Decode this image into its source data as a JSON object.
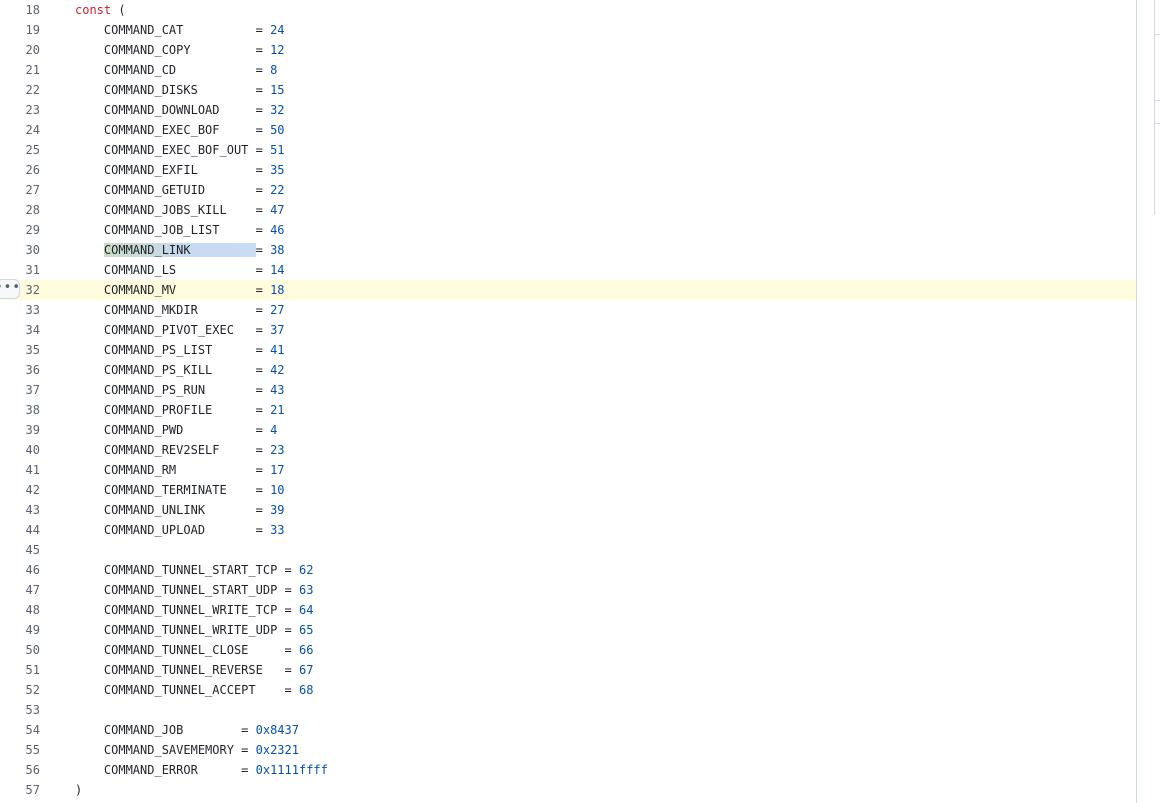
{
  "gutter_menu_icon": "kebab-horizontal-icon",
  "gutter_menu_glyph": "•••",
  "lines": [
    {
      "n": "18",
      "parts": [
        {
          "t": "const",
          "c": "kw"
        },
        {
          "t": " ("
        }
      ]
    },
    {
      "n": "19",
      "parts": [
        {
          "t": "    COMMAND_CAT          = "
        },
        {
          "t": "24",
          "c": "num"
        }
      ]
    },
    {
      "n": "20",
      "parts": [
        {
          "t": "    COMMAND_COPY         = "
        },
        {
          "t": "12",
          "c": "num"
        }
      ]
    },
    {
      "n": "21",
      "parts": [
        {
          "t": "    COMMAND_CD           = "
        },
        {
          "t": "8",
          "c": "num"
        }
      ]
    },
    {
      "n": "22",
      "parts": [
        {
          "t": "    COMMAND_DISKS        = "
        },
        {
          "t": "15",
          "c": "num"
        }
      ]
    },
    {
      "n": "23",
      "parts": [
        {
          "t": "    COMMAND_DOWNLOAD     = "
        },
        {
          "t": "32",
          "c": "num"
        }
      ]
    },
    {
      "n": "24",
      "parts": [
        {
          "t": "    COMMAND_EXEC_BOF     = "
        },
        {
          "t": "50",
          "c": "num"
        }
      ]
    },
    {
      "n": "25",
      "parts": [
        {
          "t": "    COMMAND_EXEC_BOF_OUT = "
        },
        {
          "t": "51",
          "c": "num"
        }
      ]
    },
    {
      "n": "26",
      "parts": [
        {
          "t": "    COMMAND_EXFIL        = "
        },
        {
          "t": "35",
          "c": "num"
        }
      ]
    },
    {
      "n": "27",
      "parts": [
        {
          "t": "    COMMAND_GETUID       = "
        },
        {
          "t": "22",
          "c": "num"
        }
      ]
    },
    {
      "n": "28",
      "parts": [
        {
          "t": "    COMMAND_JOBS_KILL    = "
        },
        {
          "t": "47",
          "c": "num"
        }
      ]
    },
    {
      "n": "29",
      "parts": [
        {
          "t": "    COMMAND_JOB_LIST     = "
        },
        {
          "t": "46",
          "c": "num"
        }
      ]
    },
    {
      "n": "30",
      "parts": [
        {
          "t": "    "
        },
        {
          "t": "COMMAND_LINK         ",
          "c": "sel"
        },
        {
          "t": "= "
        },
        {
          "t": "38",
          "c": "num"
        }
      ]
    },
    {
      "n": "31",
      "parts": [
        {
          "t": "    COMMAND_LS           = "
        },
        {
          "t": "14",
          "c": "num"
        }
      ]
    },
    {
      "n": "32",
      "hl": true,
      "parts": [
        {
          "t": "    COMMAND_MV           = "
        },
        {
          "t": "18",
          "c": "num"
        }
      ]
    },
    {
      "n": "33",
      "parts": [
        {
          "t": "    COMMAND_MKDIR        = "
        },
        {
          "t": "27",
          "c": "num"
        }
      ]
    },
    {
      "n": "34",
      "parts": [
        {
          "t": "    COMMAND_PIVOT_EXEC   = "
        },
        {
          "t": "37",
          "c": "num"
        }
      ]
    },
    {
      "n": "35",
      "parts": [
        {
          "t": "    COMMAND_PS_LIST      = "
        },
        {
          "t": "41",
          "c": "num"
        }
      ]
    },
    {
      "n": "36",
      "parts": [
        {
          "t": "    COMMAND_PS_KILL      = "
        },
        {
          "t": "42",
          "c": "num"
        }
      ]
    },
    {
      "n": "37",
      "parts": [
        {
          "t": "    COMMAND_PS_RUN       = "
        },
        {
          "t": "43",
          "c": "num"
        }
      ]
    },
    {
      "n": "38",
      "parts": [
        {
          "t": "    COMMAND_PROFILE      = "
        },
        {
          "t": "21",
          "c": "num"
        }
      ]
    },
    {
      "n": "39",
      "parts": [
        {
          "t": "    COMMAND_PWD          = "
        },
        {
          "t": "4",
          "c": "num"
        }
      ]
    },
    {
      "n": "40",
      "parts": [
        {
          "t": "    COMMAND_REV2SELF     = "
        },
        {
          "t": "23",
          "c": "num"
        }
      ]
    },
    {
      "n": "41",
      "parts": [
        {
          "t": "    COMMAND_RM           = "
        },
        {
          "t": "17",
          "c": "num"
        }
      ]
    },
    {
      "n": "42",
      "parts": [
        {
          "t": "    COMMAND_TERMINATE    = "
        },
        {
          "t": "10",
          "c": "num"
        }
      ]
    },
    {
      "n": "43",
      "parts": [
        {
          "t": "    COMMAND_UNLINK       = "
        },
        {
          "t": "39",
          "c": "num"
        }
      ]
    },
    {
      "n": "44",
      "parts": [
        {
          "t": "    COMMAND_UPLOAD       = "
        },
        {
          "t": "33",
          "c": "num"
        }
      ]
    },
    {
      "n": "45",
      "parts": []
    },
    {
      "n": "46",
      "parts": [
        {
          "t": "    COMMAND_TUNNEL_START_TCP = "
        },
        {
          "t": "62",
          "c": "num"
        }
      ]
    },
    {
      "n": "47",
      "parts": [
        {
          "t": "    COMMAND_TUNNEL_START_UDP = "
        },
        {
          "t": "63",
          "c": "num"
        }
      ]
    },
    {
      "n": "48",
      "parts": [
        {
          "t": "    COMMAND_TUNNEL_WRITE_TCP = "
        },
        {
          "t": "64",
          "c": "num"
        }
      ]
    },
    {
      "n": "49",
      "parts": [
        {
          "t": "    COMMAND_TUNNEL_WRITE_UDP = "
        },
        {
          "t": "65",
          "c": "num"
        }
      ]
    },
    {
      "n": "50",
      "parts": [
        {
          "t": "    COMMAND_TUNNEL_CLOSE     = "
        },
        {
          "t": "66",
          "c": "num"
        }
      ]
    },
    {
      "n": "51",
      "parts": [
        {
          "t": "    COMMAND_TUNNEL_REVERSE   = "
        },
        {
          "t": "67",
          "c": "num"
        }
      ]
    },
    {
      "n": "52",
      "parts": [
        {
          "t": "    COMMAND_TUNNEL_ACCEPT    = "
        },
        {
          "t": "68",
          "c": "num"
        }
      ]
    },
    {
      "n": "53",
      "parts": []
    },
    {
      "n": "54",
      "parts": [
        {
          "t": "    COMMAND_JOB        = "
        },
        {
          "t": "0x8437",
          "c": "num"
        }
      ]
    },
    {
      "n": "55",
      "parts": [
        {
          "t": "    COMMAND_SAVEMEMORY = "
        },
        {
          "t": "0x2321",
          "c": "num"
        }
      ]
    },
    {
      "n": "56",
      "parts": [
        {
          "t": "    COMMAND_ERROR      = "
        },
        {
          "t": "0x1111ffff",
          "c": "num"
        }
      ]
    },
    {
      "n": "57",
      "parts": [
        {
          "t": ")"
        }
      ]
    }
  ]
}
